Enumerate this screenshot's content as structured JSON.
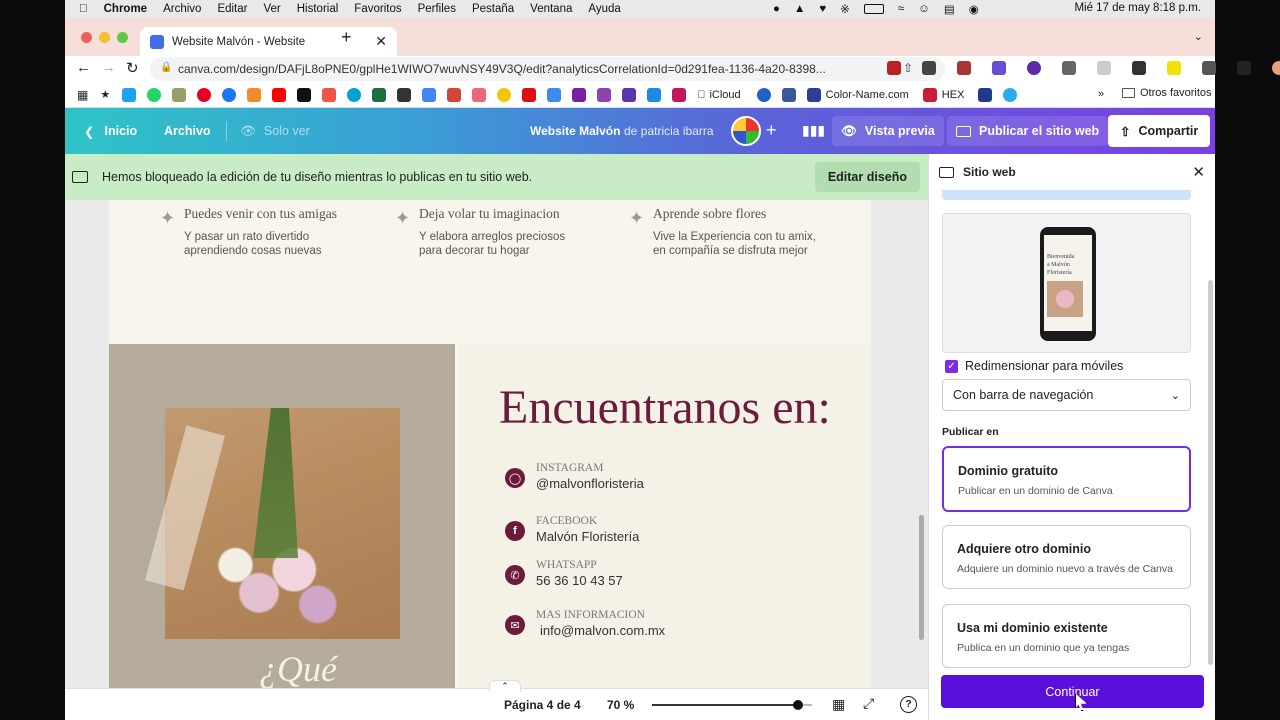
{
  "mac_menu": {
    "app": "Chrome",
    "items": [
      "Archivo",
      "Editar",
      "Ver",
      "Historial",
      "Favoritos",
      "Perfiles",
      "Pestaña",
      "Ventana",
      "Ayuda"
    ],
    "datetime": "Mié 17 de may  8:18 p.m."
  },
  "browser": {
    "tab_title": "Website Malvón - Website",
    "url": "canva.com/design/DAFjL8oPNE0/gplHe1WIWO7wuvNSY49V3Q/edit?analyticsCorrelationId=0d291fea-1136-4a20-8398...",
    "bookmarks": {
      "icloud": "iCloud",
      "color_name": "Color-Name.com",
      "hex": "HEX",
      "other": "Otros favoritos"
    }
  },
  "header": {
    "inicio": "Inicio",
    "archivo": "Archivo",
    "solo_ver": "Solo ver",
    "design_name": "Website Malvón",
    "de": "de",
    "author": "patricia ibarra",
    "vista_previa": "Vista previa",
    "publicar": "Publicar el sitio web",
    "compartir": "Compartir"
  },
  "notice": {
    "text": "Hemos bloqueado la edición de tu diseño mientras lo publicas en tu sitio web.",
    "button": "Editar diseño"
  },
  "design": {
    "features": [
      {
        "title": "Puedes venir con tus amigas",
        "line1": "Y pasar un rato divertido",
        "line2": "aprendiendo cosas nuevas"
      },
      {
        "title": "Deja volar tu imaginacion",
        "line1": "Y elabora arreglos preciosos",
        "line2": "para decorar tu hogar"
      },
      {
        "title": "Aprende sobre flores",
        "line1": "Vive la Experiencia con tu amix,",
        "line2": "en compañía se disfruta mejor"
      }
    ],
    "title": "Encuentranos en:",
    "partial_text": "¿Qué",
    "contacts": [
      {
        "label": "INSTAGRAM",
        "value": "@malvonfloristeria"
      },
      {
        "label": "FACEBOOK",
        "value": "Malvón Floristería"
      },
      {
        "label": "WHATSAPP",
        "value": "56 36 10 43 57"
      },
      {
        "label": "MAS INFORMACION",
        "value": "info@malvon.com.mx"
      }
    ]
  },
  "side_panel": {
    "title": "Sitio web",
    "phone_text": "Bienvenida a Malvón Floristería",
    "resize_label": "Redimensionar para móviles",
    "resize_checked": true,
    "nav_select": "Con barra de navegación",
    "publish_in": "Publicar en",
    "options": [
      {
        "title": "Dominio gratuito",
        "sub": "Publicar en un dominio de Canva",
        "selected": true
      },
      {
        "title": "Adquiere otro dominio",
        "sub": "Adquiere un dominio nuevo a través de Canva",
        "selected": false
      },
      {
        "title": "Usa mi dominio existente",
        "sub": "Publica en un dominio que ya tengas",
        "selected": false
      }
    ],
    "continue": "Continuar"
  },
  "bottom": {
    "page_indicator": "Página 4 de 4",
    "zoom": "70 %",
    "zoom_level": 0.7,
    "help": "?"
  },
  "colors": {
    "accent": "#7d2ae8",
    "burgundy": "#6b1b3c",
    "notice": "#c8ecc6"
  }
}
